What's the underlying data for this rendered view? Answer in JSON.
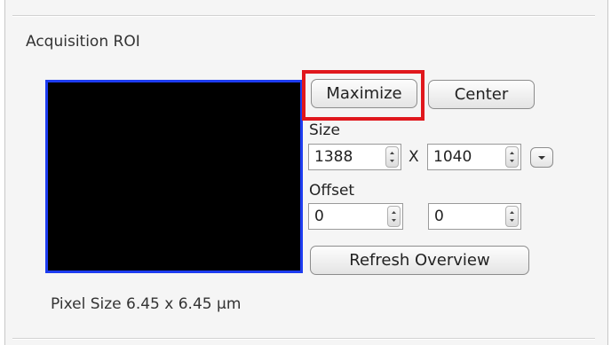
{
  "panel": {
    "title": "Acquisition ROI",
    "buttons": {
      "maximize": "Maximize",
      "center": "Center",
      "refresh_overview": "Refresh Overview"
    },
    "size": {
      "label": "Size",
      "width": "1388",
      "separator": "X",
      "height": "1040"
    },
    "offset": {
      "label": "Offset",
      "x": "0",
      "y": "0"
    },
    "pixel_size": "Pixel Size  6.45 x 6.45 µm"
  },
  "colors": {
    "highlight": "#e0171c",
    "preview_border": "#1d3cf0",
    "preview_fill": "#000000"
  },
  "icons": [
    "spin-up-icon",
    "spin-down-icon",
    "chevron-down-icon"
  ]
}
